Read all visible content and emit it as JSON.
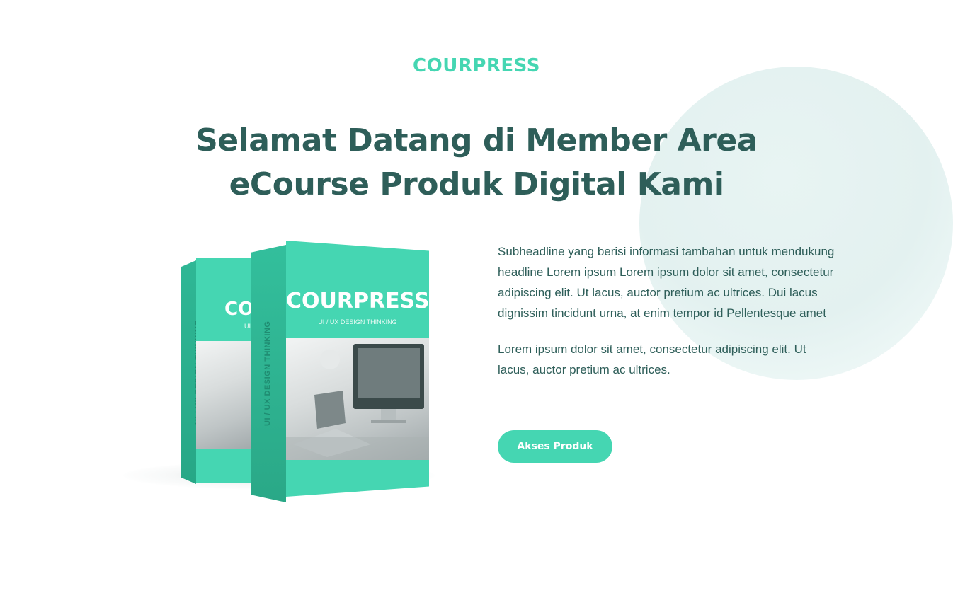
{
  "brand": {
    "name": "COURPRESS"
  },
  "hero": {
    "headline_line1": "Selamat Datang di Member Area",
    "headline_line2": "eCourse Produk Digital Kami"
  },
  "content": {
    "paragraph1": "Subheadline yang berisi informasi tambahan untuk mendukung headline Lorem ipsum Lorem ipsum dolor sit amet, consectetur adipiscing elit. Ut lacus, auctor pretium ac ultrices. Dui lacus dignissim tincidunt urna, at enim tempor id Pellentesque amet",
    "paragraph2": "Lorem ipsum dolor sit amet, consectetur adipiscing elit. Ut lacus, auctor pretium ac ultrices.",
    "cta_label": "Akses Produk"
  },
  "product_box": {
    "title": "COURPRESS",
    "back_title": "CO",
    "subtitle": "UI / UX DESIGN THINKING",
    "back_subtitle": "UI",
    "spine_text": "UI / UX DESIGN THINKING"
  },
  "colors": {
    "accent": "#45d6b2",
    "heading": "#2e5e59",
    "text": "#2e5e59",
    "background": "#ffffff",
    "circle": "#e3f1f0"
  }
}
